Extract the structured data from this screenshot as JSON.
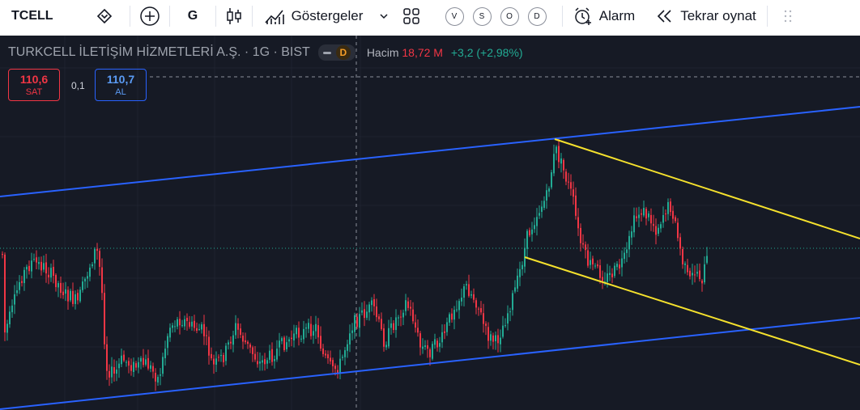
{
  "toolbar": {
    "symbol": "TCELL",
    "interval": "G",
    "indicators_label": "Göstergeler",
    "template_buttons": [
      "V",
      "S",
      "O",
      "D"
    ],
    "alert_label": "Alarm",
    "replay_label": "Tekrar oynat",
    "icons": [
      "diamond-down-icon",
      "plus-circle-icon",
      "candles-icon",
      "indicators-icon",
      "chevron-down-icon",
      "layout-grid-icon",
      "alarm-clock-icon",
      "rewind-icon",
      "drag-handle-icon"
    ]
  },
  "legend": {
    "title": "TURKCELL İLETİŞİM HİZMETLERİ A.Ş. · 1G · BIST",
    "badge": "D",
    "volume_label": "Hacim",
    "volume_value": "18,72 M",
    "change": "+3,2 (+2,98%)"
  },
  "order_panel": {
    "sell_price": "110,6",
    "sell_label": "SAT",
    "spread": "0,1",
    "buy_price": "110,7",
    "buy_label": "AL"
  },
  "colors": {
    "background": "#161a25",
    "up": "#22ab94",
    "down": "#f23645",
    "channel": "#2962ff",
    "trend": "#f5e12d",
    "accent_orange": "#f59d28"
  }
}
